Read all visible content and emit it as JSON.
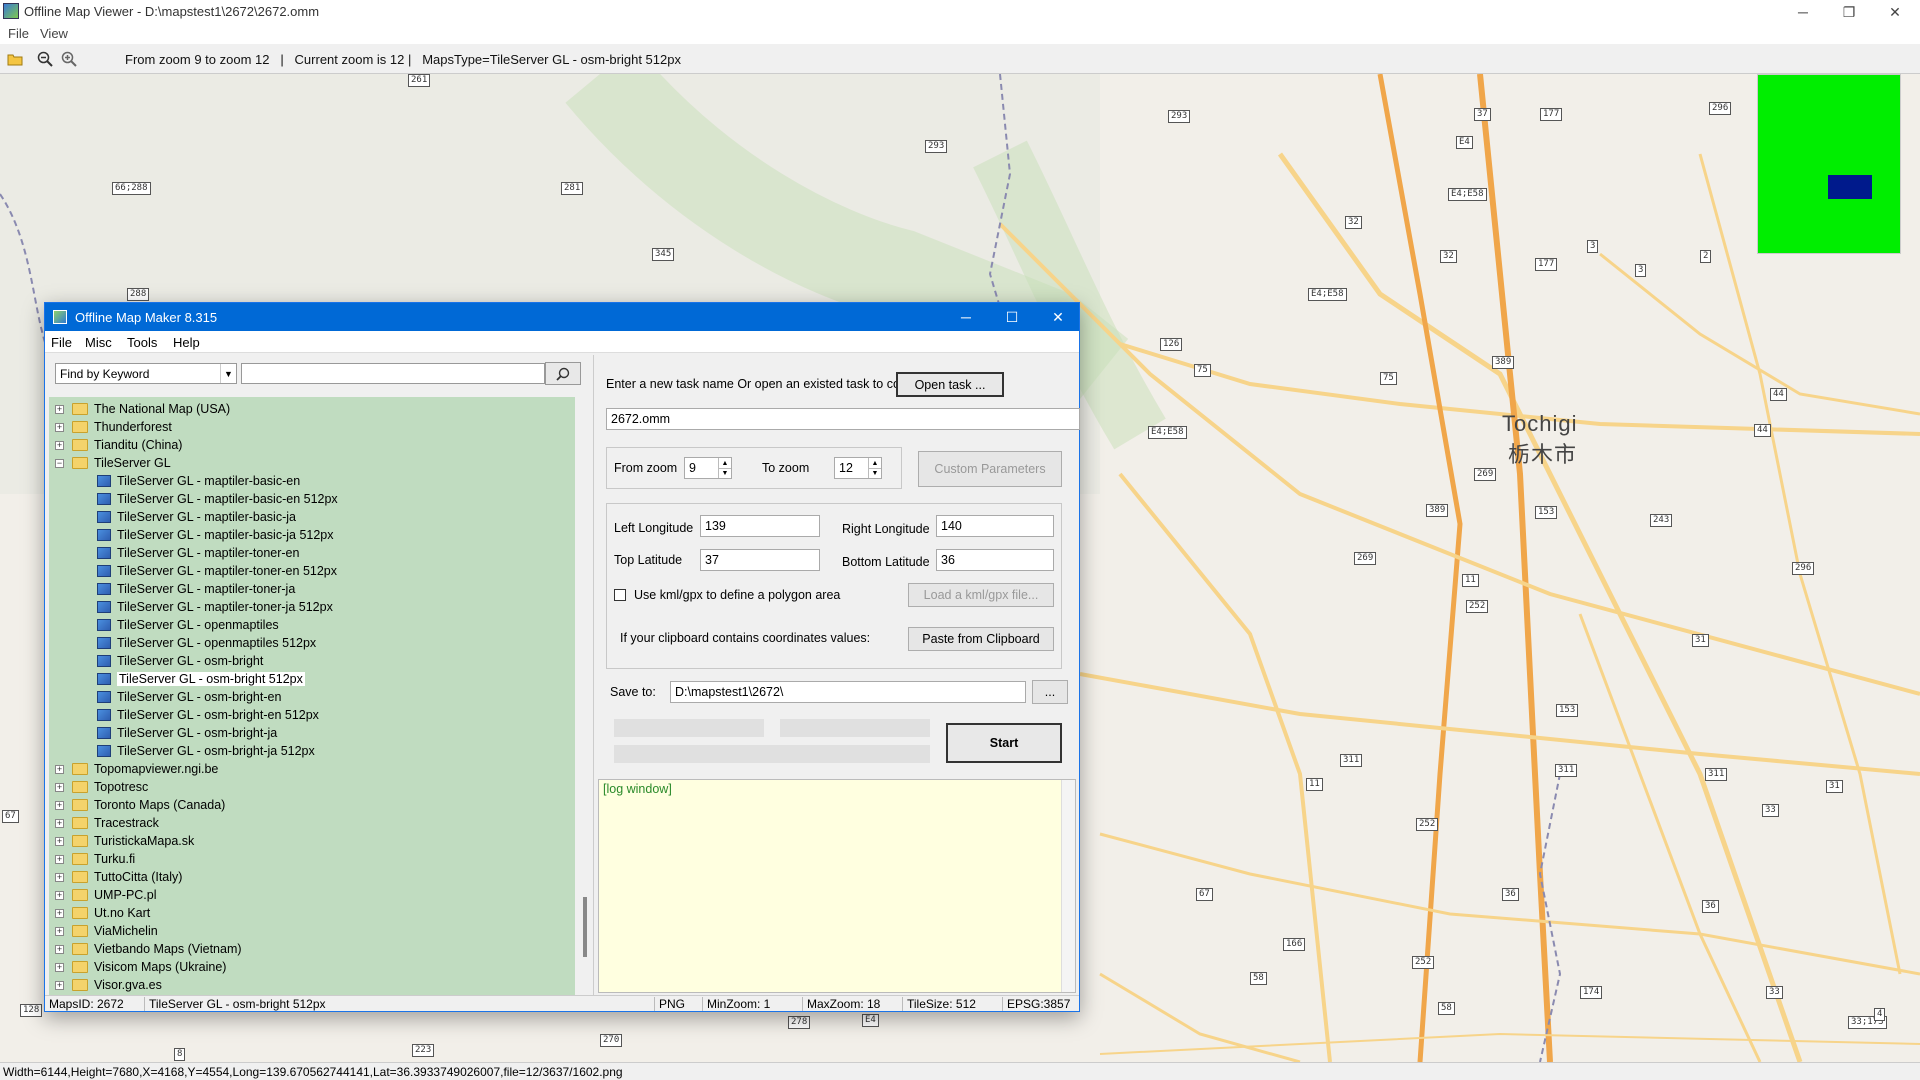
{
  "outer": {
    "title": "Offline Map Viewer - D:\\mapstest1\\2672\\2672.omm",
    "menu": [
      "File",
      "View"
    ],
    "toolbar_text": "From zoom 9 to zoom 12   |   Current zoom is 12 |   MapsType=TileServer GL - osm-bright 512px",
    "status": "Width=6144,Height=7680,X=4168,Y=4554,Long=139.670562744141,Lat=36.3933749026007,file=12/3637/1602.png"
  },
  "map": {
    "city_en": "Tochigi",
    "city_ja": "栃木市",
    "minimap_color": "#00ee00",
    "minimap_view_color": "#001a8c",
    "shields": [
      "261",
      "293",
      "293",
      "345",
      "281",
      "66;288",
      "288",
      "37",
      "177",
      "296",
      "E4",
      "E4;E58",
      "32",
      "3",
      "2",
      "E4;E58",
      "32",
      "177",
      "3",
      "2",
      "126",
      "389",
      "44",
      "44",
      "75",
      "75",
      "E4;E58",
      "269",
      "153",
      "243",
      "389",
      "269",
      "296",
      "11",
      "252",
      "31",
      "153",
      "311",
      "311",
      "311",
      "31",
      "11",
      "252",
      "33",
      "67",
      "36",
      "36",
      "166",
      "58",
      "252",
      "58",
      "174",
      "33",
      "33;173",
      "4",
      "E4",
      "278",
      "270",
      "223",
      "128",
      "67",
      "8",
      "9",
      "278",
      "E4"
    ]
  },
  "dialog": {
    "title": "Offline Map Maker 8.315",
    "menu": [
      "File",
      "Misc",
      "Tools",
      "Help"
    ],
    "find_mode": "Find by Keyword",
    "find_value": "",
    "tree": [
      {
        "label": "The National Map (USA)",
        "type": "folder",
        "expanded": false
      },
      {
        "label": "Thunderforest",
        "type": "folder",
        "expanded": false
      },
      {
        "label": "Tianditu (China)",
        "type": "folder",
        "expanded": false
      },
      {
        "label": "TileServer GL",
        "type": "folder",
        "expanded": true
      },
      {
        "label": "TileServer GL - maptiler-basic-en",
        "type": "map"
      },
      {
        "label": "TileServer GL - maptiler-basic-en 512px",
        "type": "map"
      },
      {
        "label": "TileServer GL - maptiler-basic-ja",
        "type": "map"
      },
      {
        "label": "TileServer GL - maptiler-basic-ja 512px",
        "type": "map"
      },
      {
        "label": "TileServer GL - maptiler-toner-en",
        "type": "map"
      },
      {
        "label": "TileServer GL - maptiler-toner-en 512px",
        "type": "map"
      },
      {
        "label": "TileServer GL - maptiler-toner-ja",
        "type": "map"
      },
      {
        "label": "TileServer GL - maptiler-toner-ja 512px",
        "type": "map"
      },
      {
        "label": "TileServer GL - openmaptiles",
        "type": "map"
      },
      {
        "label": "TileServer GL - openmaptiles 512px",
        "type": "map"
      },
      {
        "label": "TileServer GL - osm-bright",
        "type": "map"
      },
      {
        "label": "TileServer GL - osm-bright 512px",
        "type": "map",
        "selected": true
      },
      {
        "label": "TileServer GL - osm-bright-en",
        "type": "map"
      },
      {
        "label": "TileServer GL - osm-bright-en 512px",
        "type": "map"
      },
      {
        "label": "TileServer GL - osm-bright-ja",
        "type": "map"
      },
      {
        "label": "TileServer GL - osm-bright-ja 512px",
        "type": "map"
      },
      {
        "label": "Topomapviewer.ngi.be",
        "type": "folder",
        "expanded": false
      },
      {
        "label": "Topotresc",
        "type": "folder",
        "expanded": false
      },
      {
        "label": "Toronto Maps (Canada)",
        "type": "folder",
        "expanded": false
      },
      {
        "label": "Tracestrack",
        "type": "folder",
        "expanded": false
      },
      {
        "label": "TuristickaMapa.sk",
        "type": "folder",
        "expanded": false
      },
      {
        "label": "Turku.fi",
        "type": "folder",
        "expanded": false
      },
      {
        "label": "TuttoCitta (Italy)",
        "type": "folder",
        "expanded": false
      },
      {
        "label": "UMP-PC.pl",
        "type": "folder",
        "expanded": false
      },
      {
        "label": "Ut.no Kart",
        "type": "folder",
        "expanded": false
      },
      {
        "label": "ViaMichelin",
        "type": "folder",
        "expanded": false
      },
      {
        "label": "Vietbando Maps (Vietnam)",
        "type": "folder",
        "expanded": false
      },
      {
        "label": "Visicom Maps (Ukraine)",
        "type": "folder",
        "expanded": false
      },
      {
        "label": "Visor.gva.es",
        "type": "folder",
        "expanded": false
      }
    ],
    "task_prompt": "Enter a new task name Or open an existed task to continue:",
    "open_task_label": "Open task ...",
    "task_name": "2672.omm",
    "from_zoom_label": "From zoom",
    "from_zoom": "9",
    "to_zoom_label": "To zoom",
    "to_zoom": "12",
    "custom_params_label": "Custom Parameters",
    "left_lon_label": "Left Longitude",
    "left_lon": "139",
    "right_lon_label": "Right Longitude",
    "right_lon": "140",
    "top_lat_label": "Top Latitude",
    "top_lat": "37",
    "bottom_lat_label": "Bottom Latitude",
    "bottom_lat": "36",
    "kml_label": "Use kml/gpx to define a polygon area",
    "kml_checked": false,
    "load_kml_label": "Load a kml/gpx file...",
    "clipboard_label": "If your clipboard contains coordinates values:",
    "paste_label": "Paste from Clipboard",
    "save_to_label": "Save to:",
    "save_to": "D:\\mapstest1\\2672\\",
    "browse_label": "...",
    "start_label": "Start",
    "log_text": "[log window]",
    "status": {
      "maps_id": "MapsID: 2672",
      "map_name": "TileServer GL - osm-bright 512px",
      "format": "PNG",
      "min_zoom": "MinZoom: 1",
      "max_zoom": "MaxZoom: 18",
      "tile_size": "TileSize: 512",
      "epsg": "EPSG:3857"
    }
  }
}
